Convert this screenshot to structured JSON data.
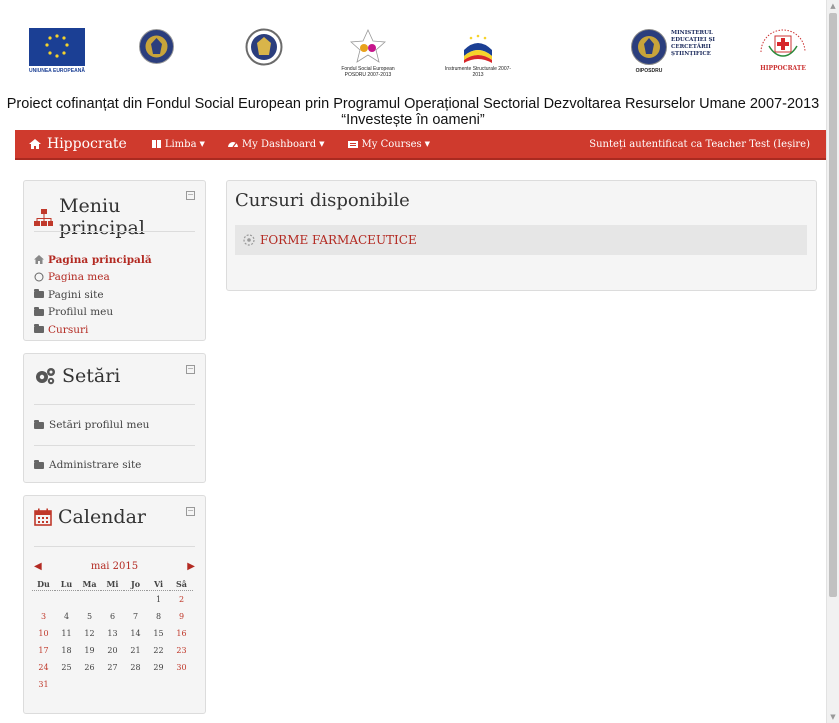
{
  "logos": {
    "eu": "UNIUNEA EUROPEANĂ",
    "fse": "Fondul Social European POSDRU 2007-2013",
    "instrumente": "Instrumente Structurale 2007-2013",
    "oiposdru": "OIPOSDRU",
    "ministerul": "MINISTERUL EDUCAȚIEI ȘI CERCETĂRII ȘTIINȚIFICE",
    "hippocrate": "HIPPOCRATE"
  },
  "tagline": {
    "line1": "Proiect cofinanțat din Fondul Social European prin Programul Operațional Sectorial Dezvoltarea Resurselor Umane 2007-2013",
    "line2": "“Investește în oameni”"
  },
  "navbar": {
    "brand": "Hippocrate",
    "limba": "Limba",
    "dashboard": "My Dashboard",
    "courses": "My Courses",
    "auth": "Sunteți autentificat ca Teacher Test (Ieșire)"
  },
  "menu": {
    "title": "Meniu principal",
    "items": [
      "Pagina principală",
      "Pagina mea",
      "Pagini site",
      "Profilul meu",
      "Cursuri"
    ]
  },
  "settings": {
    "title": "Setări",
    "profile": "Setări profilul meu",
    "admin": "Administrare site"
  },
  "calendar": {
    "title": "Calendar",
    "month": "mai 2015",
    "days": [
      "Du",
      "Lu",
      "Ma",
      "Mi",
      "Jo",
      "Vi",
      "Sâ"
    ],
    "weeks": [
      [
        "",
        "",
        "",
        "",
        "",
        "1",
        "2"
      ],
      [
        "3",
        "4",
        "5",
        "6",
        "7",
        "8",
        "9"
      ],
      [
        "10",
        "11",
        "12",
        "13",
        "14",
        "15",
        "16"
      ],
      [
        "17",
        "18",
        "19",
        "20",
        "21",
        "22",
        "23"
      ],
      [
        "24",
        "25",
        "26",
        "27",
        "28",
        "29",
        "30"
      ],
      [
        "31",
        "",
        "",
        "",
        "",
        "",
        ""
      ]
    ]
  },
  "main": {
    "title": "Cursuri disponibile",
    "course": "FORME FARMACEUTICE"
  },
  "colors": {
    "brand_red": "#cf3a2d",
    "link_red": "#b32a22"
  }
}
